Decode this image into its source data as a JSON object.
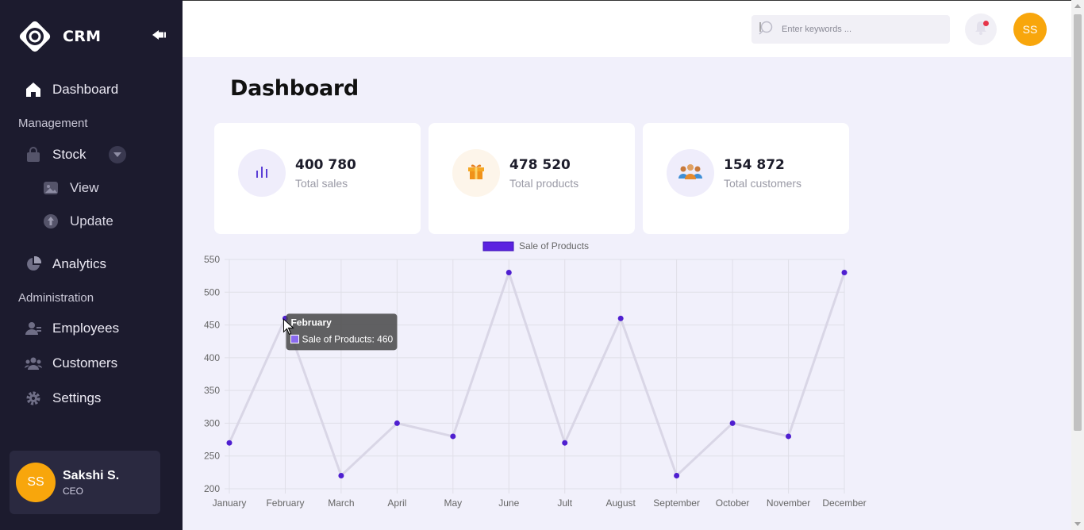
{
  "app": {
    "name": "CRM"
  },
  "sidebar": {
    "dashboard": "Dashboard",
    "section_management": "Management",
    "stock": "Stock",
    "stock_view": "View",
    "stock_update": "Update",
    "analytics": "Analytics",
    "section_administration": "Administration",
    "employees": "Employees",
    "customers": "Customers",
    "settings": "Settings",
    "user": {
      "initials": "SS",
      "name": "Sakshi S.",
      "role": "CEO"
    }
  },
  "topbar": {
    "search_placeholder": "Enter keywords ...",
    "avatar_initials": "SS"
  },
  "page": {
    "title": "Dashboard"
  },
  "stats": [
    {
      "value": "400 780",
      "caption": "Total sales",
      "icon": "bar-chart-icon",
      "icon_color": "#5b3fd6",
      "bg": "#efedfb"
    },
    {
      "value": "478 520",
      "caption": "Total products",
      "icon": "gift-icon",
      "icon_color": "#f5a623",
      "bg": "#fdf5ea"
    },
    {
      "value": "154 872",
      "caption": "Total customers",
      "icon": "people-icon",
      "icon_color": "#e08a3c",
      "bg": "#efedfb"
    }
  ],
  "colors": {
    "sidebar_bg": "#1c1b2e",
    "accent": "#5b22e0",
    "avatar": "#f8a60c",
    "line": "#d9d6e6"
  },
  "chart_data": {
    "type": "line",
    "title": "",
    "categories": [
      "January",
      "February",
      "March",
      "April",
      "May",
      "June",
      "Jult",
      "August",
      "September",
      "October",
      "November",
      "December"
    ],
    "series": [
      {
        "name": "Sale of Products",
        "values": [
          270,
          460,
          220,
          300,
          280,
          530,
          270,
          460,
          220,
          300,
          280,
          530
        ]
      }
    ],
    "ylim": [
      200,
      550
    ],
    "yticks": [
      200,
      250,
      300,
      350,
      400,
      450,
      500,
      550
    ],
    "grid": true,
    "legend": "top",
    "tooltip": {
      "title": "February",
      "label": "Sale of Products: 460",
      "category_index": 1
    }
  }
}
